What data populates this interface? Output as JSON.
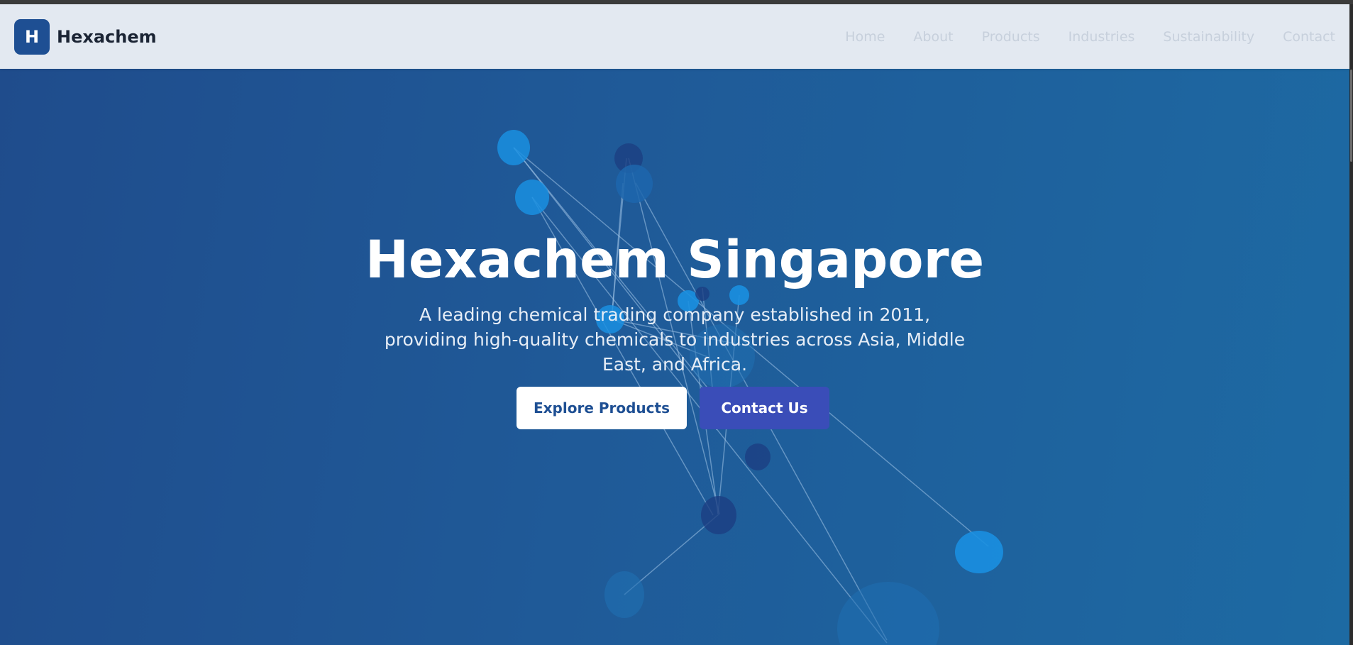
{
  "nav": {
    "logo_letter": "H",
    "brand": "Hexachem",
    "links": [
      "Home",
      "About",
      "Products",
      "Industries",
      "Sustainability",
      "Contact"
    ]
  },
  "hero": {
    "title": "Hexachem Singapore",
    "subtitle": "A leading chemical trading company established in 2011, providing high-quality chemicals to industries across Asia, Middle East, and Africa.",
    "primary_button": "Explore Products",
    "secondary_button": "Contact Us"
  },
  "colors": {
    "nav_bg": "#e3e9f1",
    "brand_blue": "#1e4f93",
    "accent_indigo": "#3a4db8",
    "molecule_light": "#1a8fe0",
    "molecule_dark": "#1c3f82"
  }
}
